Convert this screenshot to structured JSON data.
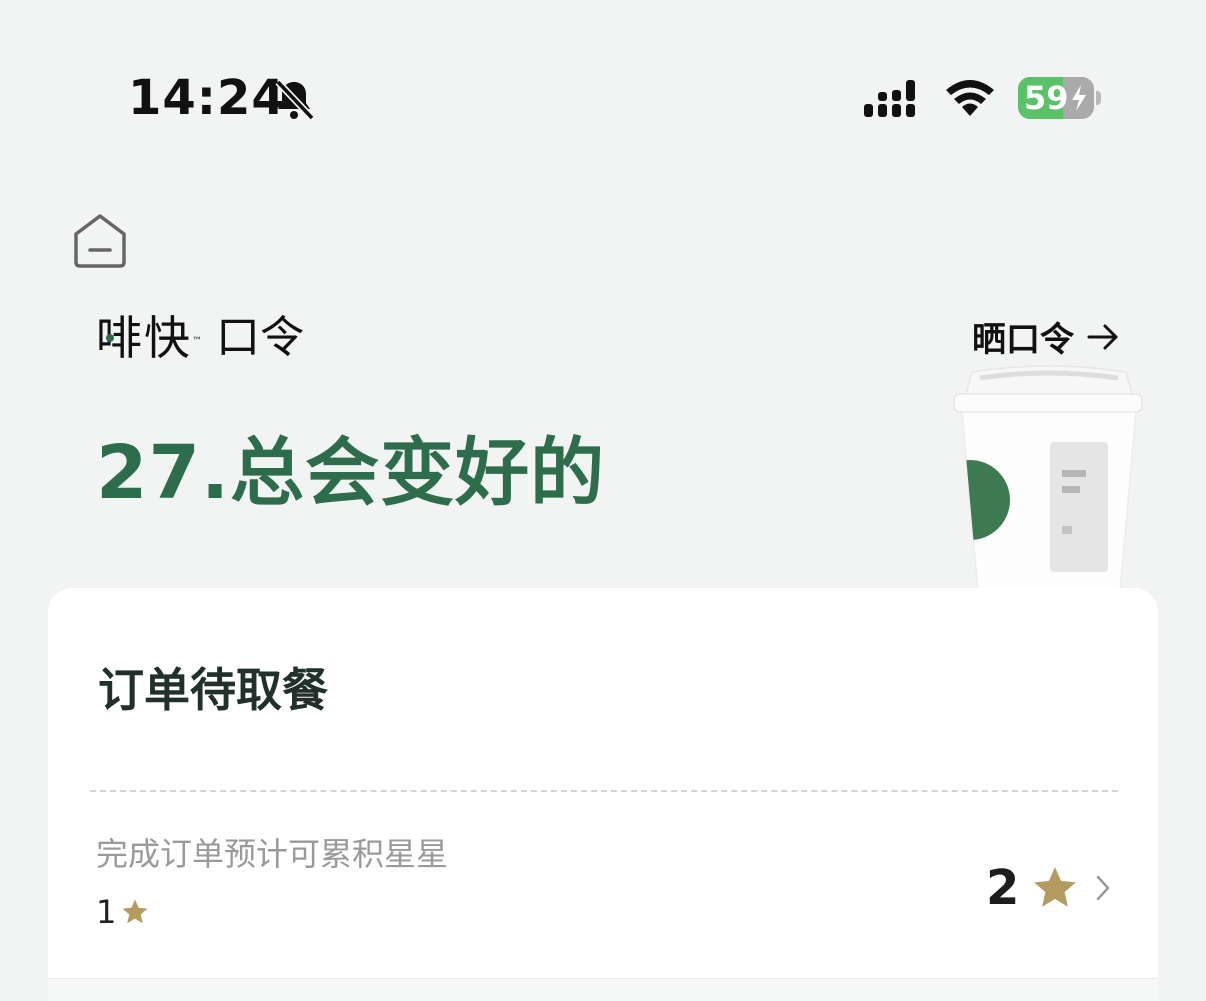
{
  "status_bar": {
    "time": "14:24",
    "battery_percent": 59,
    "battery_text": "59"
  },
  "brand": {
    "logo_text": "啡快",
    "logo_tm": "™",
    "subtitle": "口令"
  },
  "share": {
    "label": "晒口令"
  },
  "password": {
    "text": "27.总会变好的"
  },
  "order_card": {
    "title": "订单待取餐",
    "stars_label": "完成订单预计可累积星星",
    "stars_small_value": "1",
    "stars_count": "2"
  },
  "colors": {
    "accent_green": "#2e6d4b",
    "star_gold": "#b49b5f",
    "battery_green": "#5cc26a"
  },
  "icons": [
    "bell-slash-icon",
    "signal-icon",
    "wifi-icon",
    "battery-icon",
    "home-icon",
    "arrow-right-icon",
    "star-icon",
    "chevron-right-icon",
    "coffee-cup-illustration"
  ]
}
